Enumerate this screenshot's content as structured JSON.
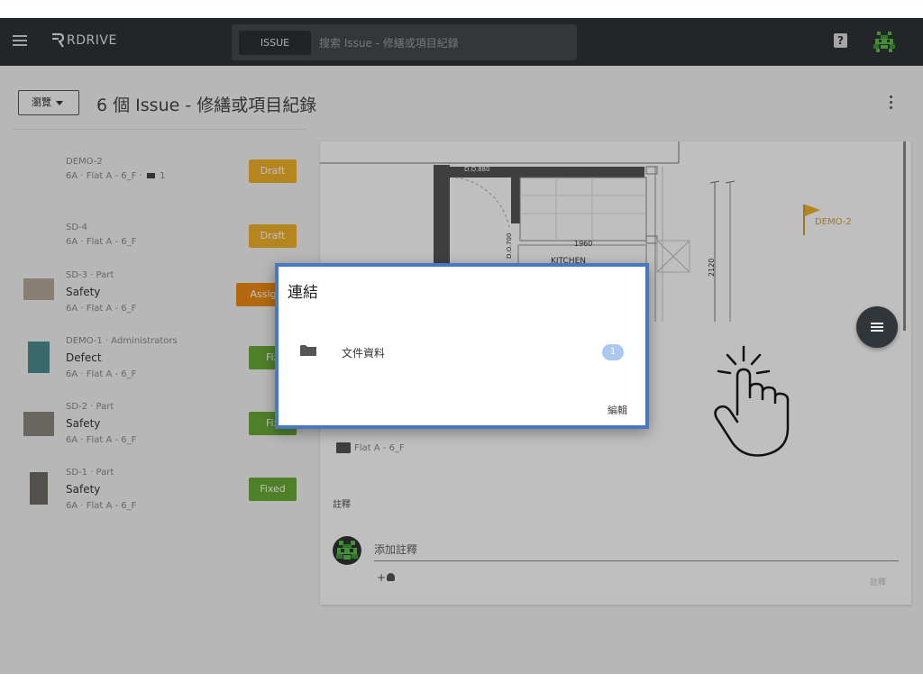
{
  "app": {
    "name": "RDRIVE"
  },
  "search": {
    "chip_label": "ISSUE",
    "placeholder": "搜索 Issue - 修繕或項目紀錄"
  },
  "header": {
    "browse_label": "瀏覽",
    "title": "6 個 Issue - 修繕或項目紀錄"
  },
  "issues": [
    {
      "ref": "DEMO-2",
      "category": "",
      "location": "6A · Flat A - 6_F ·",
      "folder_count": "1",
      "status": "Draft",
      "has_thumb": false
    },
    {
      "ref": "SD-4",
      "category": "",
      "location": "6A · Flat A - 6_F",
      "folder_count": "",
      "status": "Draft",
      "has_thumb": false
    },
    {
      "ref": "SD-3 · Part",
      "category": "Safety",
      "location": "6A · Flat A - 6_F",
      "folder_count": "",
      "status": "Assign",
      "has_thumb": true
    },
    {
      "ref": "DEMO-1 · Administrators",
      "category": "Defect",
      "location": "6A · Flat A - 6_F",
      "folder_count": "",
      "status": "Fix",
      "has_thumb": true
    },
    {
      "ref": "SD-2 · Part",
      "category": "Safety",
      "location": "6A · Flat A - 6_F",
      "folder_count": "",
      "status": "Fix",
      "has_thumb": true
    },
    {
      "ref": "SD-1 · Part",
      "category": "Safety",
      "location": "6A · Flat A - 6_F",
      "folder_count": "",
      "status": "Fixed",
      "has_thumb": true
    }
  ],
  "floorplan": {
    "door_label": "D.O.880",
    "door_label_2": "D.O.700",
    "room_label": "KITCHEN",
    "dim_width": "1960",
    "dim_height": "2120",
    "pin_label": "DEMO-2"
  },
  "detail": {
    "location": "Flat A - 6_F",
    "notes_label": "註釋",
    "comment_placeholder": "添加註釋",
    "submit_label": "註釋"
  },
  "dialog": {
    "title": "連結",
    "item_label": "文件資料",
    "item_count": "1",
    "edit_label": "編輯"
  },
  "colors": {
    "topbar": "#2e3336",
    "draft": "#f2b32b",
    "assigned": "#ee8c12",
    "fixed": "#6aab36",
    "dialog_border": "#4a77c4"
  }
}
